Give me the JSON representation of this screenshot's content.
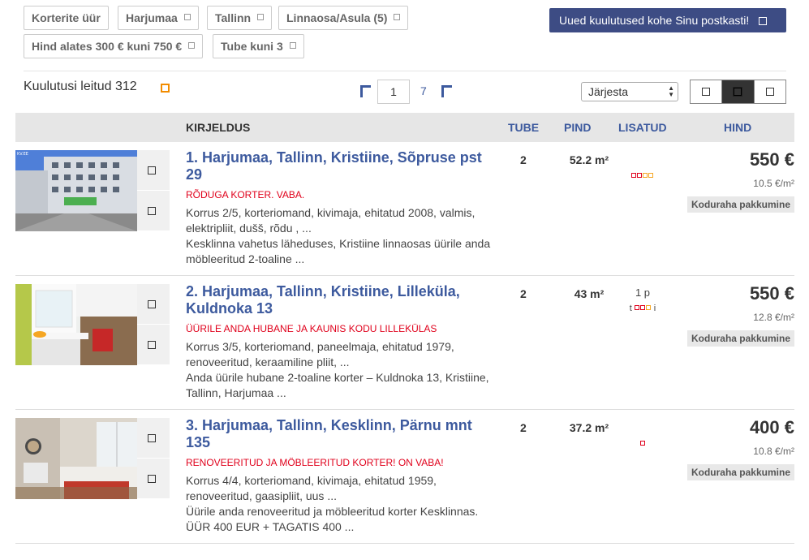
{
  "filters": [
    {
      "label": "Korterite üür",
      "removable": false
    },
    {
      "label": "Harjumaa",
      "removable": true
    },
    {
      "label": "Tallinn",
      "removable": true
    },
    {
      "label": "Linnaosa/Asula (5)",
      "removable": true
    },
    {
      "label": "Hind alates 300 € kuni 750 €",
      "removable": true
    },
    {
      "label": "Tube kuni 3",
      "removable": true
    }
  ],
  "subscribe_label": "Uued kuulutused kohe Sinu postkasti!",
  "results": {
    "label": "Kuulutusi leitud 312"
  },
  "pagination": {
    "current": "1",
    "total": "7"
  },
  "sort": {
    "selected": "Järjesta"
  },
  "table_headers": {
    "description": "KIRJELDUS",
    "rooms": "TUBE",
    "area": "PIND",
    "extras": "LISATUD",
    "price": "HIND"
  },
  "listings": [
    {
      "title": "1. Harjumaa, Tallinn, Kristiine, Sõpruse pst 29",
      "subtitle": "RÕDUGA KORTER. VABA.",
      "details": "Korrus 2/5, korteriomand, kivimaja, ehitatud 2008, valmis, elektripliit, dušš, rõdu , ...",
      "summary": "Kesklinna vahetus läheduses, Kristiine linnaosas üürile anda möbleeritud 2-toaline ...",
      "rooms": "2",
      "area": "52.2 m²",
      "price": "550 €",
      "price_per_sqm": "10.5 €/m²",
      "badge": "Koduraha pakkumine",
      "photo_watermark": "KV.EE"
    },
    {
      "title": "2. Harjumaa, Tallinn, Kristiine, Lilleküla, Kuldnoka 13",
      "subtitle": "ÜÜRILE ANDA HUBANE JA KAUNIS KODU LILLEKÜLAS",
      "details": "Korrus 3/5, korteriomand, paneelmaja, ehitatud 1979, renoveeritud, keraamiline pliit, ...",
      "summary": "Anda üürile hubane 2-toaline korter – Kuldnoka 13, Kristiine, Tallinn, Harjumaa ...",
      "rooms": "2",
      "area": "43 m²",
      "price": "550 €",
      "price_per_sqm": "12.8 €/m²",
      "badge": "Koduraha pakkumine",
      "extras_line1": "1 p",
      "extras_left": "t",
      "extras_right": "i"
    },
    {
      "title": "3. Harjumaa, Tallinn, Kesklinn, Pärnu mnt 135",
      "subtitle": "RENOVEERITUD JA MÖBLEERITUD KORTER! ON VABA!",
      "details": "Korrus 4/4, korteriomand, kivimaja, ehitatud 1959, renoveeritud, gaasipliit, uus ...",
      "summary": "Üürile anda renoveeritud ja möbleeritud korter Kesklinnas. ÜÜR 400 EUR + TAGATIS 400 ...",
      "rooms": "2",
      "area": "37.2 m²",
      "price": "400 €",
      "price_per_sqm": "10.8 €/m²",
      "badge": "Koduraha pakkumine"
    }
  ],
  "icons": {
    "remove": "remove-filter-icon",
    "prev": "prev-page-icon",
    "next": "next-page-icon",
    "favorite": "favorite-icon",
    "compare": "compare-icon"
  }
}
